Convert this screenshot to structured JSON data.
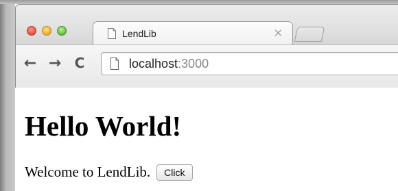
{
  "window": {
    "controls": {
      "close_icon": "close-dot-icon",
      "minimize_icon": "minimize-dot-icon",
      "zoom_icon": "zoom-dot-icon",
      "close_color": "#f05b4d",
      "minimize_color": "#f6b73d",
      "zoom_color": "#75c64c"
    }
  },
  "tabs": [
    {
      "title": "LendLib",
      "favicon_icon": "page-icon",
      "close_glyph": "×",
      "active": true
    }
  ],
  "toolbar": {
    "back_glyph": "←",
    "forward_glyph": "→",
    "reload_glyph": "C",
    "address": {
      "host": "localhost",
      "port": ":3000",
      "page_icon": "page-icon"
    }
  },
  "page": {
    "heading": "Hello World!",
    "welcome_text": "Welcome to LendLib.",
    "button_label": "Click"
  }
}
